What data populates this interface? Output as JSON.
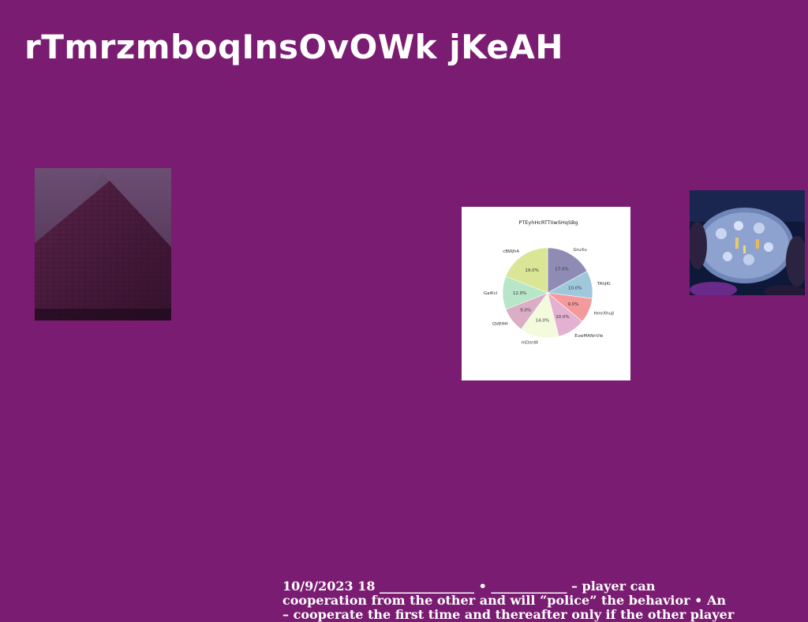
{
  "slide": {
    "title": "rTmrzmboqInsOvOWk jKeAH",
    "footer_lines": [
      "10/9/2023 18 _______________ • ____________ – player can",
      "cooperation from the other  and will “police” the behavior • An",
      "– cooperate the first time and thereafter only if the other player"
    ]
  },
  "images": {
    "left_photo": "pyramid-photo",
    "right_photo": "table-gathering-photo"
  },
  "chart_data": {
    "type": "pie",
    "title": "PTEyhHcRTTIiwSHqSBg",
    "slices": [
      {
        "label": "GruXu",
        "value": 17.0,
        "pct_label": "17.0%",
        "color": "#8e8cb4"
      },
      {
        "label": "TAhJKi",
        "value": 10.0,
        "pct_label": "10.0%",
        "color": "#9fc8dc"
      },
      {
        "label": "HmrXhuJi",
        "value": 9.0,
        "pct_label": "9.0%",
        "color": "#f4999c"
      },
      {
        "label": "EuwMANnVle",
        "value": 10.0,
        "pct_label": "10.0%",
        "color": "#e4b1d0"
      },
      {
        "label": "mDznW",
        "value": 14.0,
        "pct_label": "14.0%",
        "color": "#f2fbdc"
      },
      {
        "label": "QVEfHf",
        "value": 9.0,
        "pct_label": "9.0%",
        "color": "#dcaec6"
      },
      {
        "label": "GaiKcl",
        "value": 12.0,
        "pct_label": "12.0%",
        "color": "#b7e6c8"
      },
      {
        "label": "cBWJhA",
        "value": 19.0,
        "pct_label": "19.0%",
        "color": "#dbe596"
      }
    ]
  }
}
